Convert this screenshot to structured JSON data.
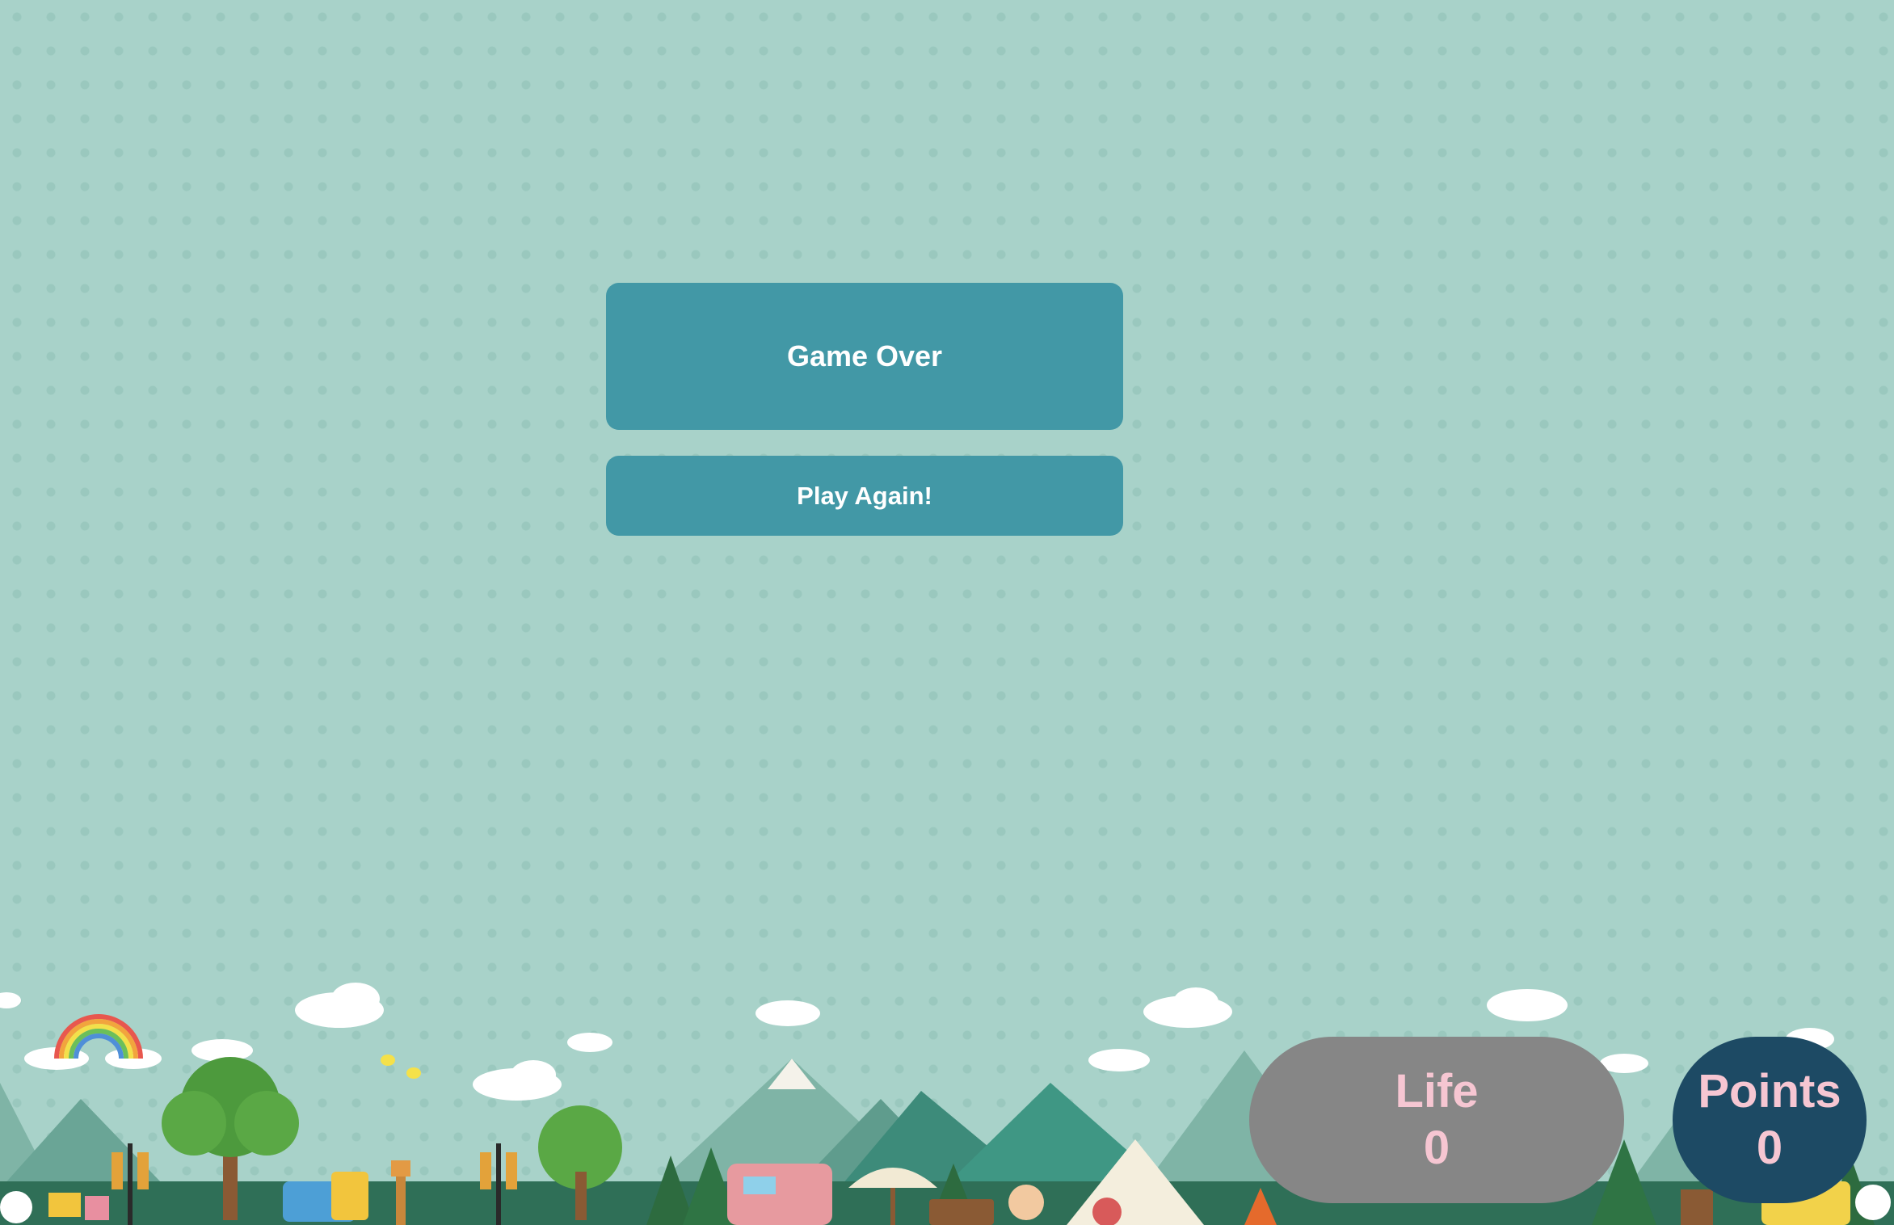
{
  "game": {
    "title": "Game Over",
    "play_again_label": "Play Again!"
  },
  "hud": {
    "life_label": "Life",
    "life_value": "0",
    "points_label": "Points",
    "points_value": "0"
  },
  "colors": {
    "background": "#a8d2c9",
    "panel": "#4298a6",
    "life_pill": "#868686",
    "points_pill": "#1d4a64",
    "hud_text": "#f6c6d2"
  }
}
